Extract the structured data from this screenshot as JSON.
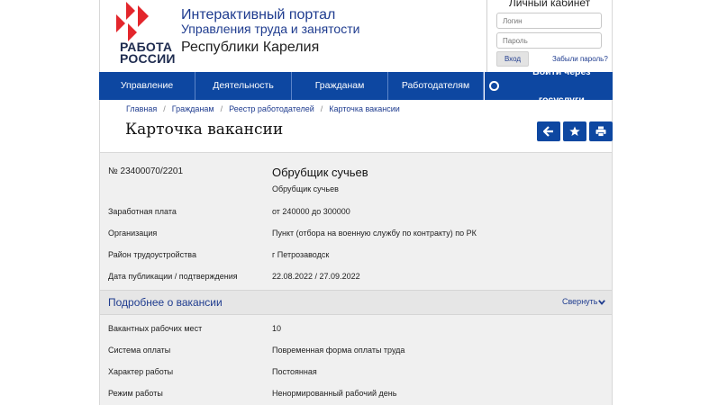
{
  "logo": {
    "line1": "РАБОТА",
    "line2": "РОССИИ"
  },
  "portal": {
    "line1": "Интерактивный портал",
    "line2": "Управления труда и занятости",
    "line3": "Республики Карелия"
  },
  "cabinet": {
    "title": "Личный кабинет",
    "login_placeholder": "Логин",
    "password_placeholder": "Пароль",
    "login_button": "Вход",
    "forgot_link": "Забыли пароль?"
  },
  "nav": {
    "items": [
      "Управление",
      "Деятельность",
      "Гражданам",
      "Работодателям"
    ],
    "gosuslugi": "Войти через госуслуги"
  },
  "breadcrumb": [
    "Главная",
    "Гражданам",
    "Реестр работодателей",
    "Карточка вакансии"
  ],
  "page_title": "Карточка вакансии",
  "toolbar": {
    "back_icon": "arrow-left-icon",
    "favorite_icon": "star-icon",
    "print_icon": "printer-icon"
  },
  "vacancy": {
    "number": "№ 23400070/2201",
    "title": "Обрубщик сучьев",
    "subtitle": "Обрубщик сучьев",
    "fields": [
      {
        "label": "Заработная плата",
        "value": "от 240000 до 300000"
      },
      {
        "label": "Организация",
        "value": "Пункт (отбора на военную службу по контракту) по РК"
      },
      {
        "label": "Район трудоустройства",
        "value": "г Петрозаводск"
      },
      {
        "label": "Дата публикации / подтверждения",
        "value": "22.08.2022 / 27.09.2022"
      }
    ]
  },
  "details": {
    "heading": "Подробнее о вакансии",
    "toggle": "Свернуть",
    "fields": [
      {
        "label": "Вакантных рабочих мест",
        "value": "10"
      },
      {
        "label": "Система оплаты",
        "value": "Повременная форма оплаты труда"
      },
      {
        "label": "Характер работы",
        "value": "Постоянная"
      },
      {
        "label": "Режим работы",
        "value": "Ненормированный рабочий день"
      }
    ]
  },
  "colors": {
    "primary": "#0d47a1",
    "link": "#1f3c8f",
    "logo_red": "#e3262c"
  }
}
